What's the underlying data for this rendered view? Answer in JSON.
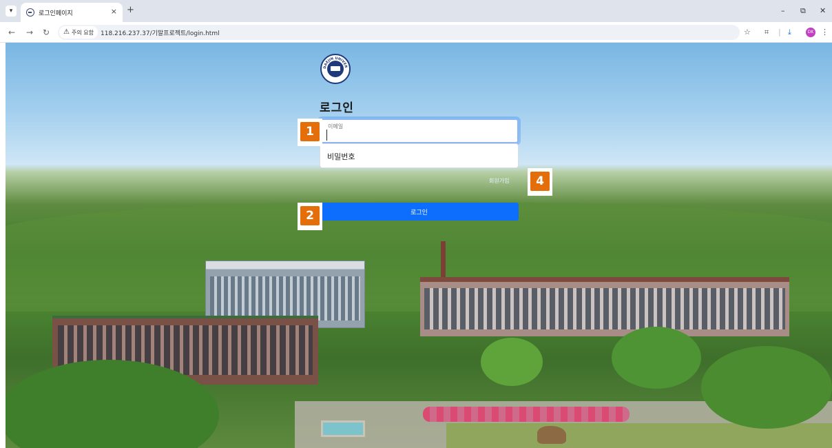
{
  "browser": {
    "tab_title": "로그인페이지",
    "new_tab": "+",
    "tab_close": "×",
    "security_label": "주의 요함",
    "url": "118.216.237.37/기말프로젝트/login.html",
    "profile_initials": "DK"
  },
  "login": {
    "title": "로그인",
    "email_label": "이메일",
    "email_value": "",
    "password_placeholder": "비밀번호",
    "signup_link": "회원가입",
    "submit_label": "로그인"
  },
  "logo_text": "DAEJIN UNIVERSITY",
  "annotations": [
    "1",
    "2",
    "4"
  ],
  "colors": {
    "primary": "#0d6efd",
    "badge": "#e36e0a",
    "logo_blue": "#1f3a7a"
  }
}
